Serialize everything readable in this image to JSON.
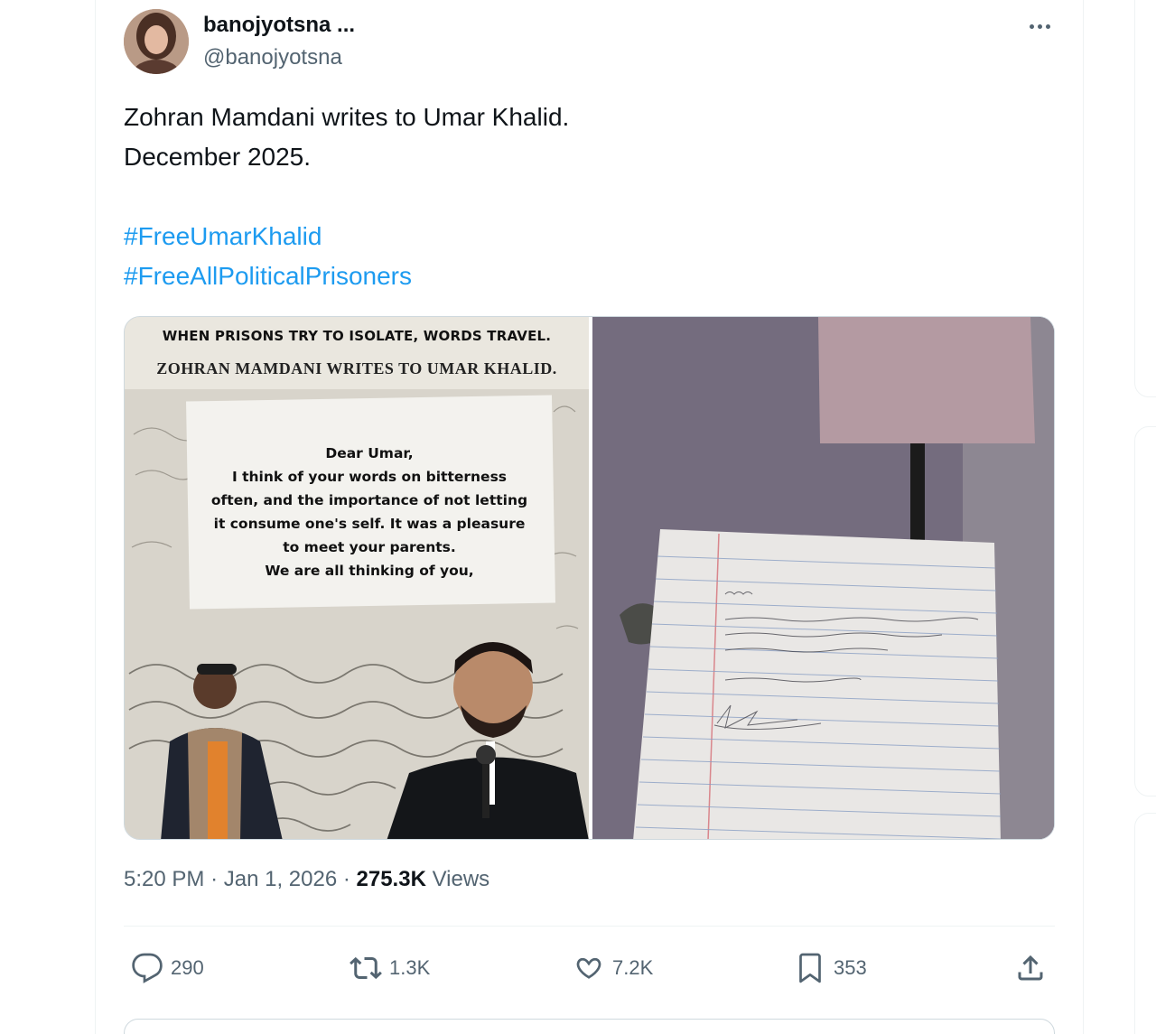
{
  "tweet": {
    "author": {
      "display_name": "banojyotsna ...",
      "handle": "@banojyotsna"
    },
    "text_lines": [
      "Zohran Mamdani writes to Umar Khalid.",
      "December 2025."
    ],
    "hashtags": [
      "#FreeUmarKhalid",
      "#FreeAllPoliticalPrisoners"
    ],
    "media": {
      "poster": {
        "heading1": "WHEN PRISONS TRY TO ISOLATE, WORDS TRAVEL.",
        "heading2": "ZOHRAN MAMDANI WRITES TO UMAR KHALID.",
        "letter_lines": [
          "Dear Umar,",
          "I think of your words on bitterness",
          "often, and the importance of not letting",
          "it consume one's self. It was a pleasure",
          "to meet your parents.",
          "We are all thinking of you,"
        ]
      }
    },
    "meta": {
      "time": "5:20 PM",
      "date": "Jan 1, 2026",
      "views_count": "275.3K",
      "views_label": "Views"
    },
    "actions": {
      "replies": "290",
      "reposts": "1.3K",
      "likes": "7.2K",
      "bookmarks": "353"
    }
  },
  "colors": {
    "link": "#1d9bf0",
    "secondary_text": "#536471",
    "primary_text": "#0f1419",
    "border": "#cfd9de"
  },
  "icons": [
    "more-icon",
    "reply-icon",
    "repost-icon",
    "like-icon",
    "bookmark-icon",
    "share-icon"
  ]
}
